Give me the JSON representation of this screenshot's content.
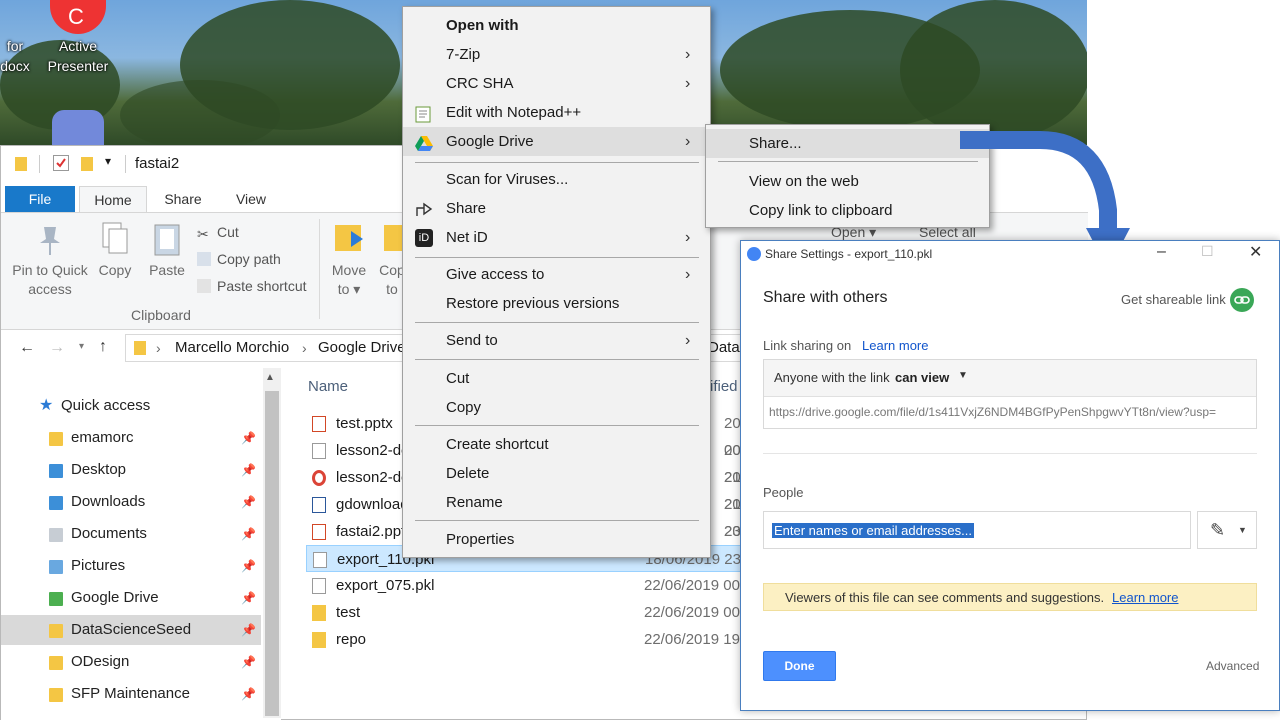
{
  "desktop": {
    "icons": [
      {
        "label_line1": "for",
        "label_line2": "docx"
      },
      {
        "label_line1": "Active",
        "label_line2": "Presenter"
      }
    ]
  },
  "explorer": {
    "window_title": "fastai2",
    "tabs": [
      "File",
      "Home",
      "Share",
      "View"
    ],
    "ribbon": {
      "pin_label": "Pin to Quick access",
      "pin_l1": "Pin to Quick",
      "pin_l2": "access",
      "copy_label": "Copy",
      "paste_label": "Paste",
      "cut_label": "Cut",
      "copy_path_label": "Copy path",
      "paste_shortcut_label": "Paste shortcut",
      "move_to_l1": "Move",
      "move_to_l2": "to",
      "copy_to_l1": "Cop",
      "copy_to_l2": "to",
      "open_label": "Open",
      "select_all_label": "Select all",
      "group_clipboard": "Clipboard"
    },
    "breadcrumb": [
      "Marcello Morchio",
      "Google Drive",
      "DataScie"
    ],
    "nav": {
      "quick_access": "Quick access",
      "items": [
        {
          "label": "emamorc"
        },
        {
          "label": "Desktop"
        },
        {
          "label": "Downloads"
        },
        {
          "label": "Documents"
        },
        {
          "label": "Pictures"
        },
        {
          "label": "Google Drive"
        },
        {
          "label": "DataScienceSeed"
        },
        {
          "label": "ODesign"
        },
        {
          "label": "SFP Maintenance"
        }
      ]
    },
    "columns": {
      "name": "Name",
      "modified": "ified"
    },
    "files": [
      {
        "name": "test.pptx",
        "date": "2019 00"
      },
      {
        "name": "lesson2-do",
        "date": "2019 21"
      },
      {
        "name": "lesson2-do",
        "date": "2019 21"
      },
      {
        "name": "gdownload",
        "date": "2019 23"
      },
      {
        "name": "fastai2.ppt",
        "date": "2019 19"
      },
      {
        "name": "export_110.pkl",
        "date": "18/06/2019 23"
      },
      {
        "name": "export_075.pkl",
        "date": "22/06/2019 00"
      },
      {
        "name": "test",
        "date": "22/06/2019 00"
      },
      {
        "name": "repo",
        "date": "22/06/2019 19"
      }
    ]
  },
  "context_menu": {
    "items": [
      {
        "label": "Open with",
        "bold": true
      },
      {
        "label": "7-Zip"
      },
      {
        "label": "CRC SHA"
      },
      {
        "label": "Edit with Notepad++"
      },
      {
        "label": "Google Drive"
      },
      {
        "label": "Scan for Viruses..."
      },
      {
        "label": "Share"
      },
      {
        "label": "Net iD"
      },
      {
        "label": "Give access to"
      },
      {
        "label": "Restore previous versions"
      },
      {
        "label": "Send to"
      },
      {
        "label": "Cut"
      },
      {
        "label": "Copy"
      },
      {
        "label": "Create shortcut"
      },
      {
        "label": "Delete"
      },
      {
        "label": "Rename"
      },
      {
        "label": "Properties"
      }
    ],
    "submenu": {
      "share": "Share...",
      "view_web": "View on the web",
      "copy_link": "Copy link to clipboard"
    }
  },
  "share_dialog": {
    "title": "Share Settings - export_110.pkl",
    "heading": "Share with others",
    "get_link": "Get shareable link",
    "link_sharing_on": "Link sharing on",
    "learn_more": "Learn more",
    "access_prefix": "Anyone with the link",
    "access_level": "can view",
    "url": "https://drive.google.com/file/d/1s411VxjZ6NDM4BGfPyPenShpgwvYTt8n/view?usp=",
    "people_label": "People",
    "people_placeholder": "Enter names or email addresses...",
    "notice": "Viewers of this file can see comments and suggestions.",
    "notice_link": "Learn more",
    "done": "Done",
    "advanced": "Advanced"
  },
  "colors": {
    "accent": "#1979ca",
    "done_button": "#4d90fe",
    "link_blue": "#1155cc",
    "notice_bg": "#fcf0c3",
    "selection": "#cce8ff"
  }
}
